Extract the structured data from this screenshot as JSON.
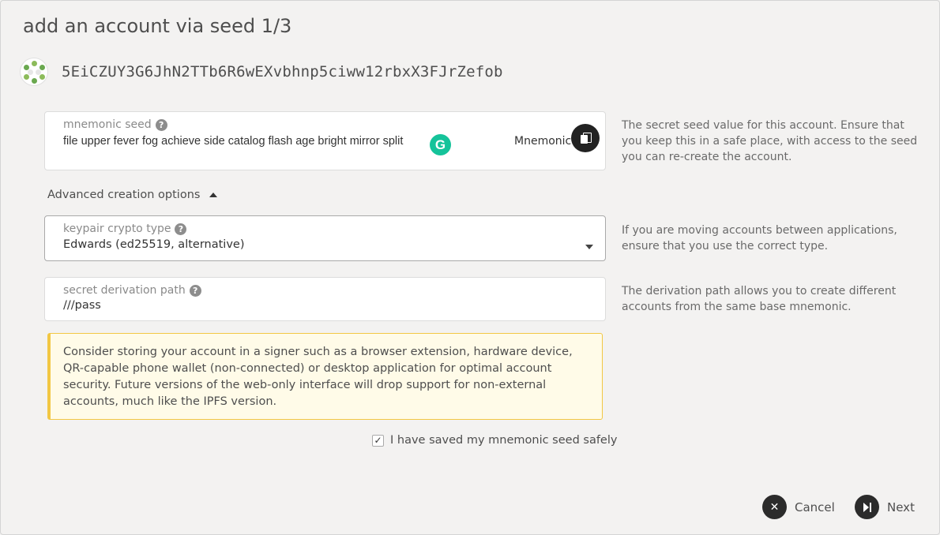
{
  "modal": {
    "title": "add an account via seed 1/3"
  },
  "account": {
    "address": "5EiCZUY3G6JhN2TTb6R6wEXvbhnp5ciww12rbxX3FJrZefob"
  },
  "seed": {
    "label": "mnemonic seed",
    "value": "file upper fever fog achieve side catalog flash age bright mirror split",
    "type_tag": "Mnemonic",
    "grammarly_letter": "G",
    "help": "The secret seed value for this account. Ensure that you keep this in a safe place, with access to the seed you can re-create the account."
  },
  "advanced": {
    "toggle_label": "Advanced creation options"
  },
  "crypto": {
    "label": "keypair crypto type",
    "value": "Edwards (ed25519, alternative)",
    "help": "If you are moving accounts between applications, ensure that you use the correct type."
  },
  "derivation": {
    "label": "secret derivation path",
    "value": "///pass",
    "help": "The derivation path allows you to create different accounts from the same base mnemonic."
  },
  "warning": {
    "text": "Consider storing your account in a signer such as a browser extension, hardware device, QR-capable phone wallet (non-connected) or desktop application for optimal account security. Future versions of the web-only interface will drop support for non-external accounts, much like the IPFS version."
  },
  "confirm": {
    "label": "I have saved my mnemonic seed safely",
    "checked": true
  },
  "actions": {
    "cancel_label": "Cancel",
    "next_label": "Next"
  },
  "colors": {
    "accent_green": "#15c39a",
    "warning_border": "#f2c744",
    "warning_bg": "#fffbe8"
  }
}
